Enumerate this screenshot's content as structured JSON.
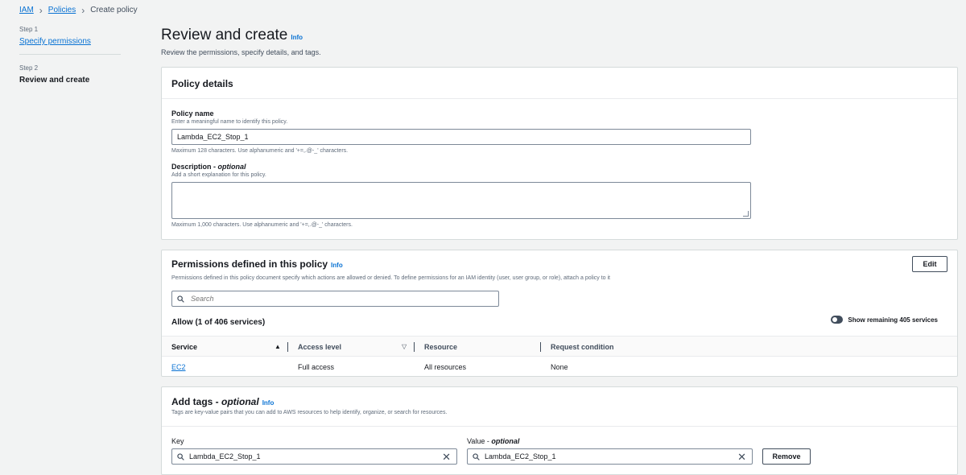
{
  "breadcrumb": {
    "items": [
      "IAM",
      "Policies"
    ],
    "current": "Create policy"
  },
  "steps": {
    "step1_label": "Step 1",
    "step1_title": "Specify permissions",
    "step2_label": "Step 2",
    "step2_title": "Review and create"
  },
  "header": {
    "title": "Review and create",
    "info": "Info",
    "subtitle": "Review the permissions, specify details, and tags."
  },
  "policy_details": {
    "title": "Policy details",
    "name_label": "Policy name",
    "name_help": "Enter a meaningful name to identify this policy.",
    "name_value": "Lambda_EC2_Stop_1",
    "name_constraint": "Maximum 128 characters. Use alphanumeric and '+=,.@-_' characters.",
    "desc_label": "Description",
    "desc_optional": "optional",
    "desc_help": "Add a short explanation for this policy.",
    "desc_value": "",
    "desc_constraint": "Maximum 1,000 characters. Use alphanumeric and '+=,.@-_' characters."
  },
  "permissions": {
    "title": "Permissions defined in this policy",
    "info": "Info",
    "description": "Permissions defined in this policy document specify which actions are allowed or denied. To define permissions for an IAM identity (user, user group, or role), attach a policy to it",
    "edit_label": "Edit",
    "search_placeholder": "Search",
    "allow_title": "Allow (1 of 406 services)",
    "toggle_label": "Show remaining 405 services",
    "columns": [
      "Service",
      "Access level",
      "Resource",
      "Request condition"
    ],
    "rows": [
      {
        "service": "EC2",
        "access_level": "Full access",
        "resource": "All resources",
        "condition": "None"
      }
    ]
  },
  "tags": {
    "title": "Add tags",
    "optional": "optional",
    "info": "Info",
    "description": "Tags are key-value pairs that you can add to AWS resources to help identify, organize, or search for resources.",
    "key_label": "Key",
    "value_label": "Value",
    "value_optional": "optional",
    "key_value": "Lambda_EC2_Stop_1",
    "value_value": "Lambda_EC2_Stop_1",
    "remove_label": "Remove"
  },
  "colors": {
    "link": "#0972d3",
    "background": "#f2f3f3",
    "text": "#16191f"
  }
}
